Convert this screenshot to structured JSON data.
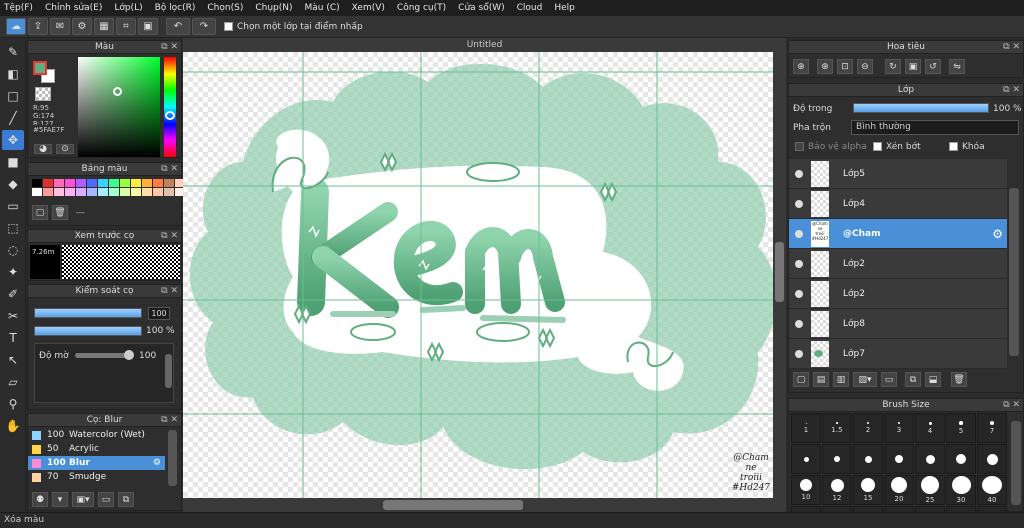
{
  "menu": [
    "Tệp(F)",
    "Chỉnh sửa(E)",
    "Lớp(L)",
    "Bộ lọc(R)",
    "Chọn(S)",
    "Chụp(N)",
    "Màu (C)",
    "Xem(V)",
    "Công cụ(T)",
    "Cửa sổ(W)",
    "Cloud",
    "Help"
  ],
  "toolbar": {
    "reference_label": "Chọn một lớp tại điểm nhấp"
  },
  "color_panel": {
    "title": "Màu",
    "r": "R:95",
    "g": "G:174",
    "b": "B:127",
    "hex": "#5FAE7F",
    "primary": "#5FAE7F"
  },
  "palette_panel": {
    "title": "Bảng màu",
    "extra": "---"
  },
  "brush_preview": {
    "title": "Xem trước cọ",
    "size": "7.26m"
  },
  "brush_control": {
    "title": "Kiểm soát cọ",
    "size_value": "100",
    "opacity_value": "100 %",
    "density_label": "Độ mờ",
    "density_value": "100"
  },
  "brush_list": {
    "title": "Cọ: Blur",
    "items": [
      {
        "num": "100",
        "name": "Watercolor (Wet)",
        "color": "#8fd1ff"
      },
      {
        "num": "50",
        "name": "Acrylic",
        "color": "#ffd54a"
      },
      {
        "num": "100",
        "name": "Blur",
        "color": "#ff8ad8"
      },
      {
        "num": "70",
        "name": "Smudge",
        "color": "#ffd0a0"
      }
    ]
  },
  "canvas": {
    "tab_title": "Untitled",
    "word": "Kem",
    "signature": [
      "@Cham",
      "ne",
      "troiii",
      "#Hd247"
    ]
  },
  "navigator": {
    "title": "Hoa tiêu"
  },
  "layer_panel": {
    "title": "Lớp",
    "opacity_label": "Độ trong",
    "opacity_value": "100 %",
    "blend_label": "Pha trộn",
    "blend_value": "Bình thường",
    "protect_alpha": "Bảo vệ alpha",
    "clipping": "Xén bớt",
    "lock": "Khóa",
    "layers": [
      "Lớp5",
      "Lớp4",
      "@Cham",
      "Lớp2",
      "Lớp2",
      "Lớp8",
      "Lớp7"
    ],
    "selected_thumb_text": [
      "@Cham",
      "ne",
      "troiii",
      "#Hd247"
    ]
  },
  "brush_size": {
    "title": "Brush Size",
    "sizes": [
      "1",
      "1.5",
      "2",
      "3",
      "4",
      "5",
      "7",
      "",
      "",
      "",
      "",
      "",
      "",
      "",
      "10",
      "12",
      "15",
      "20",
      "25",
      "30",
      "40",
      "",
      "",
      "",
      "",
      "",
      "",
      ""
    ]
  },
  "status": {
    "text": "Xóa màu"
  },
  "colors": {
    "accent": "#4a90d9",
    "mint": "#5FAE7F",
    "mint_light": "#a9d6bf"
  }
}
